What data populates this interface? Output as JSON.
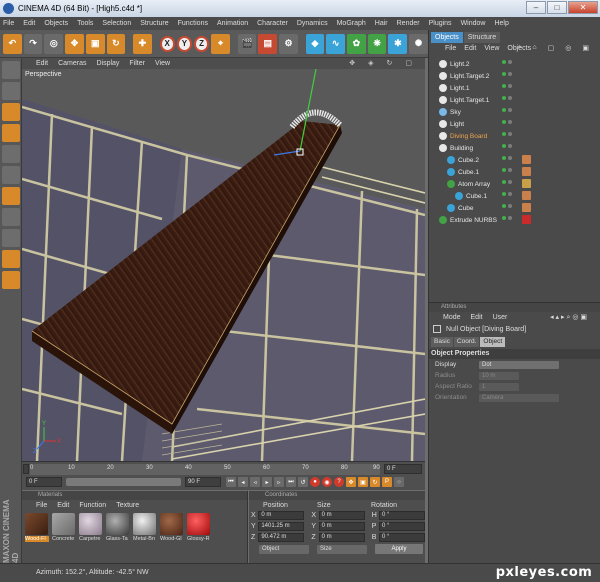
{
  "window": {
    "title": "CINEMA 4D (64 Bit) - [High5.c4d *]",
    "minimize": "–",
    "maximize": "□",
    "close": "✕"
  },
  "menu": [
    "File",
    "Edit",
    "Objects",
    "Tools",
    "Selection",
    "Structure",
    "Functions",
    "Animation",
    "Character",
    "Dynamics",
    "MoGraph",
    "Hair",
    "Render",
    "Plugins",
    "Window",
    "Help"
  ],
  "toolbar": {
    "x_axis": "X",
    "y_axis": "Y",
    "z_axis": "Z"
  },
  "viewport": {
    "menu": [
      "Edit",
      "Cameras",
      "Display",
      "Filter",
      "View"
    ],
    "label": "Perspective"
  },
  "timeline": {
    "ticks": [
      "0",
      "10",
      "20",
      "30",
      "40",
      "50",
      "60",
      "70",
      "80",
      "90"
    ],
    "current_frame": "0 F",
    "start_frame": "0 F",
    "end_frame": "90 F",
    "end_value": "0 F"
  },
  "materials": {
    "title": "Materials",
    "menu": [
      "File",
      "Edit",
      "Function",
      "Texture"
    ],
    "items": [
      {
        "label": "Wood-Fl",
        "color": "#5a3520"
      },
      {
        "label": "Concrete",
        "color": "#8a8a8a"
      },
      {
        "label": "Carpetre",
        "color": "#a89aa8"
      },
      {
        "label": "Glass-Ta",
        "color": "#6c6c6c"
      },
      {
        "label": "Metal-Bn",
        "color": "#9a9a9a"
      },
      {
        "label": "Wood-Gl",
        "color": "#6b3b28"
      },
      {
        "label": "Glossy-R",
        "color": "#d01818"
      }
    ]
  },
  "coordinates": {
    "title": "Coordinates",
    "headers": [
      "Position",
      "Size",
      "Rotation"
    ],
    "rows": [
      {
        "axis": "X",
        "pos": "0 m",
        "size": "0 m",
        "rot_axis": "H",
        "rot": "0 °"
      },
      {
        "axis": "Y",
        "pos": "1401.25 m",
        "size": "0 m",
        "rot_axis": "P",
        "rot": "0 °"
      },
      {
        "axis": "Z",
        "pos": "90.472 m",
        "size": "0 m",
        "rot_axis": "B",
        "rot": "0 °"
      }
    ],
    "mode_pos": "Object",
    "mode_size": "Size",
    "apply": "Apply"
  },
  "status": "Azimuth: 152.2°, Altitude: -42.5°  NW",
  "objects_panel": {
    "tabs": [
      "Objects",
      "Structure"
    ],
    "menu": [
      "File",
      "Edit",
      "View",
      "Objects"
    ],
    "rows": [
      {
        "name": "Light.2",
        "indent": 0,
        "icon": "#e8e8e8"
      },
      {
        "name": "Light.Target.2",
        "indent": 0,
        "icon": "#e8e8e8"
      },
      {
        "name": "Light.1",
        "indent": 0,
        "icon": "#e8e8e8"
      },
      {
        "name": "Light.Target.1",
        "indent": 0,
        "icon": "#e8e8e8"
      },
      {
        "name": "Sky",
        "indent": 0,
        "icon": "#7ab8e8"
      },
      {
        "name": "Light",
        "indent": 0,
        "icon": "#e8e8e8"
      },
      {
        "name": "Diving Board",
        "indent": 0,
        "icon": "#e8e8e8",
        "highlight": true
      },
      {
        "name": "Building",
        "indent": 0,
        "icon": "#e8e8e8"
      },
      {
        "name": "Cube.2",
        "indent": 1,
        "icon": "#3aa3d8"
      },
      {
        "name": "Cube.1",
        "indent": 1,
        "icon": "#3aa3d8"
      },
      {
        "name": "Atom Array",
        "indent": 1,
        "icon": "#43a146"
      },
      {
        "name": "Cube.1",
        "indent": 2,
        "icon": "#3aa3d8"
      },
      {
        "name": "Cube",
        "indent": 1,
        "icon": "#3aa3d8"
      },
      {
        "name": "Extrude NURBS",
        "indent": 0,
        "icon": "#43a146"
      }
    ]
  },
  "attributes": {
    "title": "Attributes",
    "menu": [
      "Mode",
      "Edit",
      "User"
    ],
    "object_name": "Null Object [Diving Board]",
    "tabs": [
      "Basic",
      "Coord.",
      "Object"
    ],
    "section": "Object Properties",
    "props": [
      {
        "label": "Display",
        "value": "Dot",
        "dim": false
      },
      {
        "label": "Radius",
        "value": "10 m",
        "dim": true
      },
      {
        "label": "Aspect Ratio",
        "value": "1",
        "dim": true
      },
      {
        "label": "Orientation",
        "value": "Camera",
        "dim": true
      }
    ]
  },
  "watermark": "pxleyes.com"
}
